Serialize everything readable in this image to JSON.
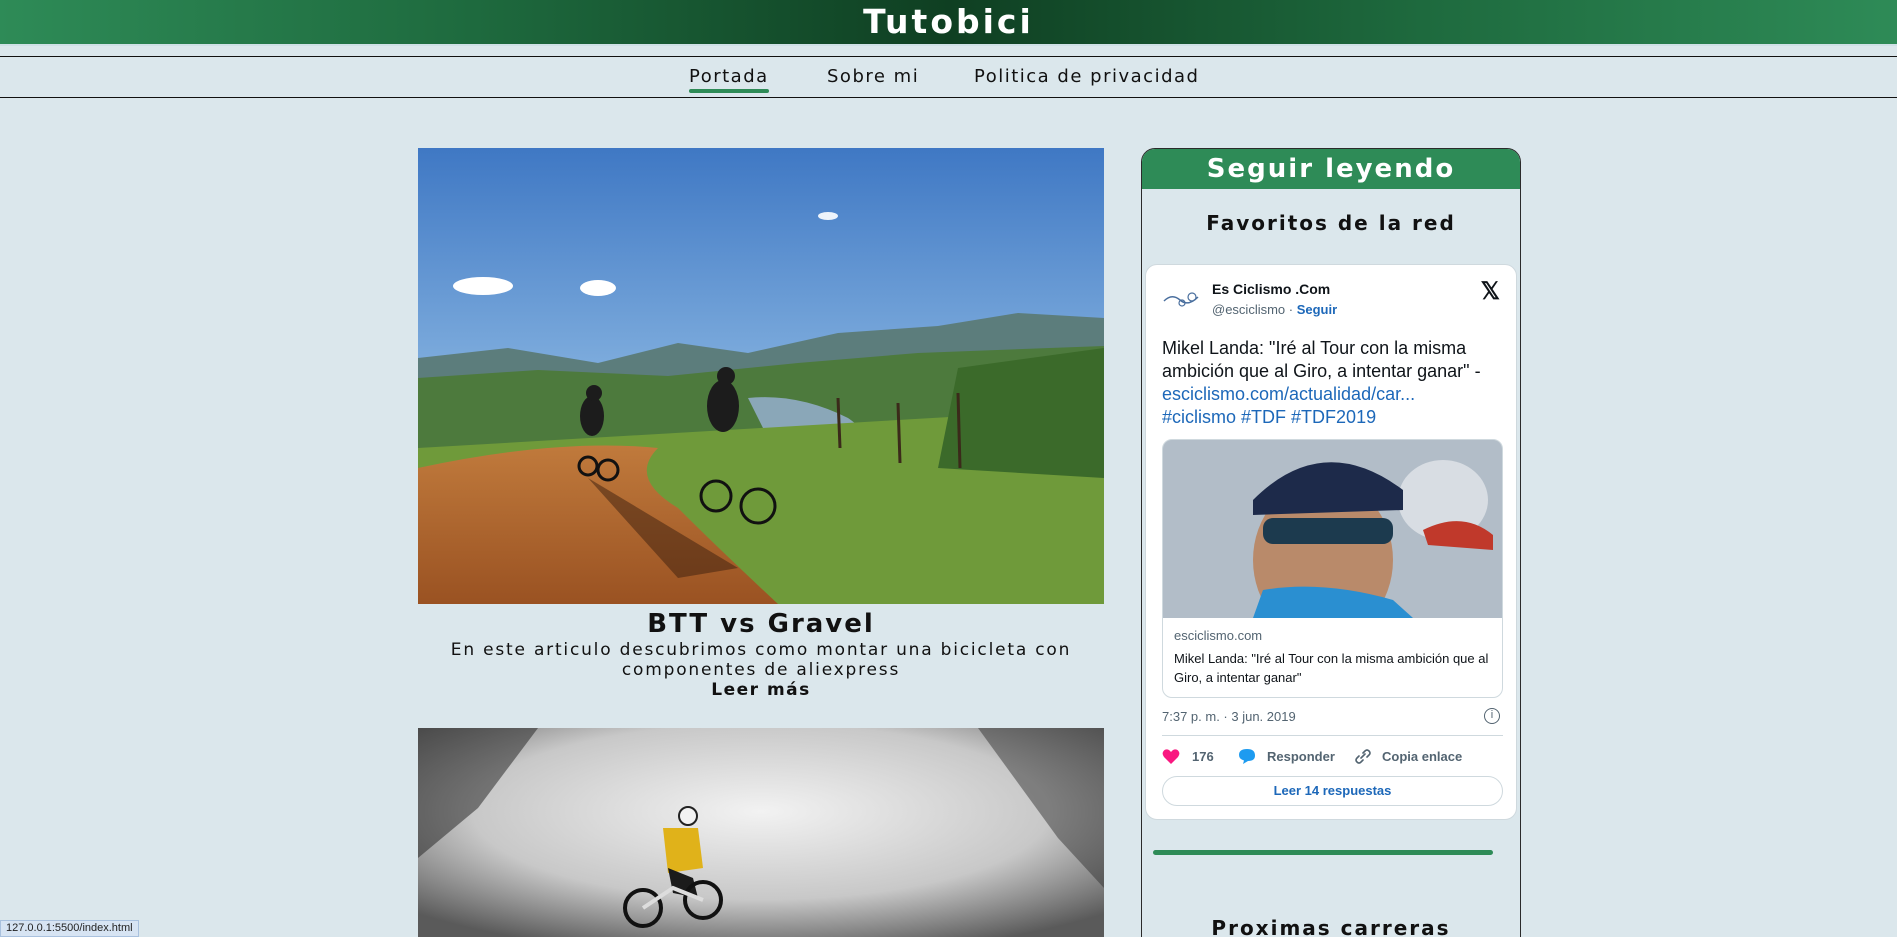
{
  "site": {
    "title": "Tutobici"
  },
  "nav": {
    "items": [
      {
        "label": "Portada",
        "active": true
      },
      {
        "label": "Sobre mi",
        "active": false
      },
      {
        "label": "Politica de privacidad",
        "active": false
      }
    ]
  },
  "articles": [
    {
      "title": "BTT vs Gravel",
      "description": "En este articulo descubrimos como montar una bicicleta con componentes de aliexpress",
      "more_label": "Leer más"
    }
  ],
  "sidebar": {
    "heading": "Seguir leyendo",
    "favorites_title": "Favoritos de la red",
    "next_title": "Proximas carreras",
    "tweet": {
      "account_name": "Es Ciclismo .Com",
      "handle": "@esciclismo",
      "handle_sep": " · ",
      "follow_label": "Seguir",
      "text": "Mikel Landa: \"Iré al Tour con la misma ambición que al Giro, a intentar ganar\" -",
      "link": "esciclismo.com/actualidad/car...",
      "hashtags": [
        "#ciclismo",
        "#TDF",
        "#TDF2019"
      ],
      "card_domain": "esciclismo.com",
      "card_title": "Mikel Landa: \"Iré al Tour con la misma ambición que al Giro, a intentar ganar\"",
      "timestamp": "7:37 p. m. · 3 jun. 2019",
      "likes": "176",
      "reply_label": "Responder",
      "copy_label": "Copia enlace",
      "read_replies_label": "Leer 14 respuestas"
    }
  },
  "status_bar": {
    "url": "127.0.0.1:5500/index.html"
  },
  "colors": {
    "accent": "#2e8b57",
    "page_bg": "#dbe7ec",
    "link": "#1d68b9",
    "like": "#f91880"
  }
}
